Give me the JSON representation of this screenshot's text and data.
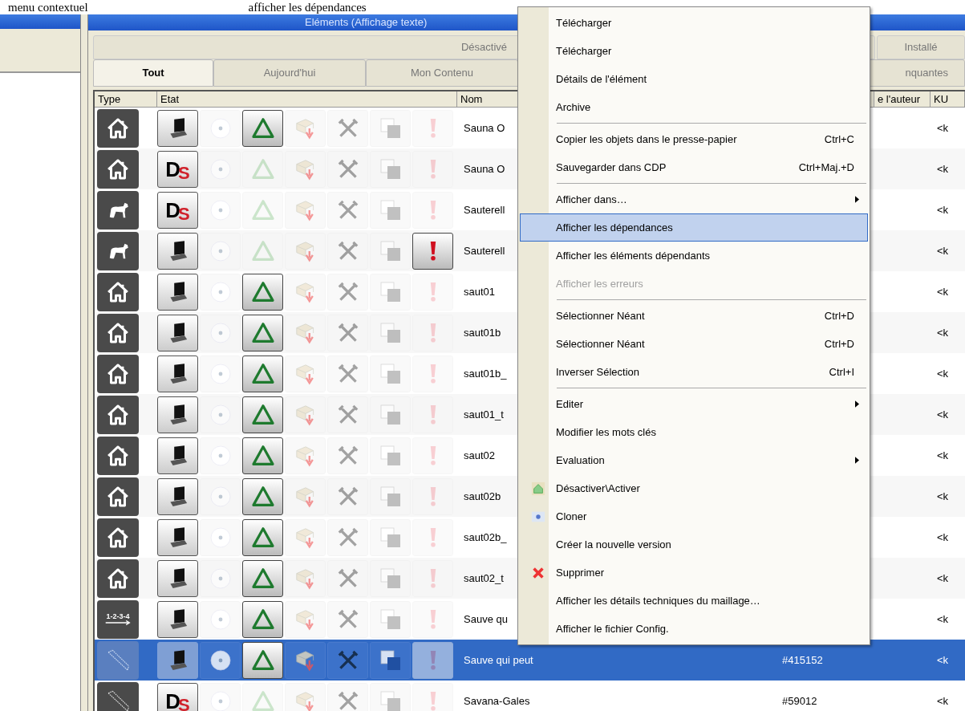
{
  "caption": {
    "left": "menu contextuel",
    "right": "afficher les dépendances"
  },
  "window": {
    "title": "Eléments (Affichage texte)"
  },
  "tabs_top": [
    {
      "label": "Désactivé",
      "selected": false
    },
    {
      "label": "Installé",
      "selected": false
    }
  ],
  "tabs": [
    {
      "label": "Tout",
      "selected": true
    },
    {
      "label": "Aujourd'hui",
      "selected": false
    },
    {
      "label": "Mon Contenu",
      "selected": false
    },
    {
      "label": "nquantes",
      "selected": false
    }
  ],
  "columns": [
    "Type",
    "Etat",
    "Nom",
    "e l'auteur",
    "KU"
  ],
  "rows": [
    {
      "type": {
        "kind": "house"
      },
      "source": {
        "kind": "laptop"
      },
      "triangle": true,
      "error": false,
      "name": "Sauna O",
      "ku": "<k",
      "selected": false
    },
    {
      "type": {
        "kind": "house"
      },
      "source": {
        "kind": "ds",
        "letters": [
          "D",
          "S"
        ]
      },
      "triangle": false,
      "error": false,
      "name": "Sauna O",
      "ku": "<k",
      "selected": false
    },
    {
      "type": {
        "kind": "dog"
      },
      "source": {
        "kind": "ds",
        "letters": [
          "D",
          "S"
        ]
      },
      "triangle": false,
      "error": false,
      "name": "Sauterell",
      "ku": "<k",
      "selected": false
    },
    {
      "type": {
        "kind": "dog"
      },
      "source": {
        "kind": "laptop"
      },
      "triangle": false,
      "error": true,
      "name": "Sauterell",
      "ku": "<k",
      "selected": false
    },
    {
      "type": {
        "kind": "house"
      },
      "source": {
        "kind": "laptop"
      },
      "triangle": true,
      "error": false,
      "name": "saut01",
      "ku": "<k",
      "selected": false
    },
    {
      "type": {
        "kind": "house"
      },
      "source": {
        "kind": "laptop"
      },
      "triangle": true,
      "error": false,
      "name": "saut01b",
      "ku": "<k",
      "selected": false
    },
    {
      "type": {
        "kind": "house"
      },
      "source": {
        "kind": "laptop"
      },
      "triangle": true,
      "error": false,
      "name": "saut01b_",
      "ku": "<k",
      "selected": false
    },
    {
      "type": {
        "kind": "house"
      },
      "source": {
        "kind": "laptop"
      },
      "triangle": true,
      "error": false,
      "name": "saut01_t",
      "ku": "<k",
      "selected": false
    },
    {
      "type": {
        "kind": "house"
      },
      "source": {
        "kind": "laptop"
      },
      "triangle": true,
      "error": false,
      "name": "saut02",
      "ku": "<k",
      "selected": false
    },
    {
      "type": {
        "kind": "house"
      },
      "source": {
        "kind": "laptop"
      },
      "triangle": true,
      "error": false,
      "name": "saut02b",
      "ku": "<k",
      "selected": false
    },
    {
      "type": {
        "kind": "house"
      },
      "source": {
        "kind": "laptop"
      },
      "triangle": true,
      "error": false,
      "name": "saut02b_",
      "ku": "<k",
      "selected": false
    },
    {
      "type": {
        "kind": "house"
      },
      "source": {
        "kind": "laptop"
      },
      "triangle": true,
      "error": false,
      "name": "saut02_t",
      "ku": "<k",
      "selected": false
    },
    {
      "type": {
        "kind": "steps",
        "label": "1-2-3-4"
      },
      "source": {
        "kind": "laptop"
      },
      "triangle": true,
      "error": false,
      "name": "Sauve qu",
      "ku": "<k",
      "selected": false
    },
    {
      "type": {
        "kind": "ribbon"
      },
      "source": {
        "kind": "laptop"
      },
      "triangle": true,
      "error": false,
      "name": "Sauve qui peut",
      "id": "#415152",
      "ku": "<k",
      "selected": true
    },
    {
      "type": {
        "kind": "ribbon"
      },
      "source": {
        "kind": "ds",
        "letters": [
          "D",
          "S"
        ]
      },
      "triangle": false,
      "error": false,
      "name": "Savana-Gales",
      "id": "#59012",
      "ku": "<k",
      "selected": false
    }
  ],
  "menu": [
    {
      "kind": "item",
      "label": "Télécharger",
      "selected": false,
      "disabled": false
    },
    {
      "kind": "item",
      "label": "Télécharger",
      "selected": false,
      "disabled": false
    },
    {
      "kind": "item",
      "label": "Détails de l'élément",
      "selected": false,
      "disabled": false
    },
    {
      "kind": "item",
      "label": "Archive",
      "selected": false,
      "disabled": false
    },
    {
      "kind": "separator"
    },
    {
      "kind": "item",
      "label": "Copier les objets dans le presse-papier",
      "shortcut": "Ctrl+C",
      "selected": false,
      "disabled": false
    },
    {
      "kind": "item",
      "label": "Sauvegarder dans CDP",
      "shortcut": "Ctrl+Maj.+D",
      "selected": false,
      "disabled": false
    },
    {
      "kind": "separator"
    },
    {
      "kind": "item",
      "label": "Afficher dans…",
      "submenu": true,
      "selected": false,
      "disabled": false
    },
    {
      "kind": "item",
      "label": "Afficher les dépendances",
      "selected": true,
      "disabled": false
    },
    {
      "kind": "item",
      "label": "Afficher les éléments dépendants",
      "selected": false,
      "disabled": false
    },
    {
      "kind": "item",
      "label": "Afficher les erreurs",
      "selected": false,
      "disabled": true
    },
    {
      "kind": "separator"
    },
    {
      "kind": "item",
      "label": "Sélectionner Néant",
      "shortcut": "Ctrl+D",
      "selected": false,
      "disabled": false
    },
    {
      "kind": "item",
      "label": "Sélectionner Néant",
      "shortcut": "Ctrl+D",
      "selected": false,
      "disabled": false
    },
    {
      "kind": "item",
      "label": "Inverser Sélection",
      "shortcut": "Ctrl+I",
      "selected": false,
      "disabled": false
    },
    {
      "kind": "separator"
    },
    {
      "kind": "item",
      "label": "Editer",
      "submenu": true,
      "selected": false,
      "disabled": false
    },
    {
      "kind": "item",
      "label": "Modifier les mots clés",
      "selected": false,
      "disabled": false
    },
    {
      "kind": "item",
      "label": "Evaluation",
      "submenu": true,
      "selected": false,
      "disabled": false
    },
    {
      "kind": "house",
      "label": "Désactiver\\Activer",
      "selected": false,
      "disabled": false
    },
    {
      "kind": "clone",
      "label": "Cloner",
      "selected": false,
      "disabled": false
    },
    {
      "kind": "item",
      "label": "Créer la nouvelle version",
      "selected": false,
      "disabled": false
    },
    {
      "kind": "delete",
      "label": "Supprimer",
      "selected": false,
      "disabled": false
    },
    {
      "kind": "item",
      "label": "Afficher les détails techniques du maillage…",
      "selected": false,
      "disabled": false
    },
    {
      "kind": "item",
      "label": "Afficher le fichier Config.",
      "selected": false,
      "disabled": false
    }
  ]
}
